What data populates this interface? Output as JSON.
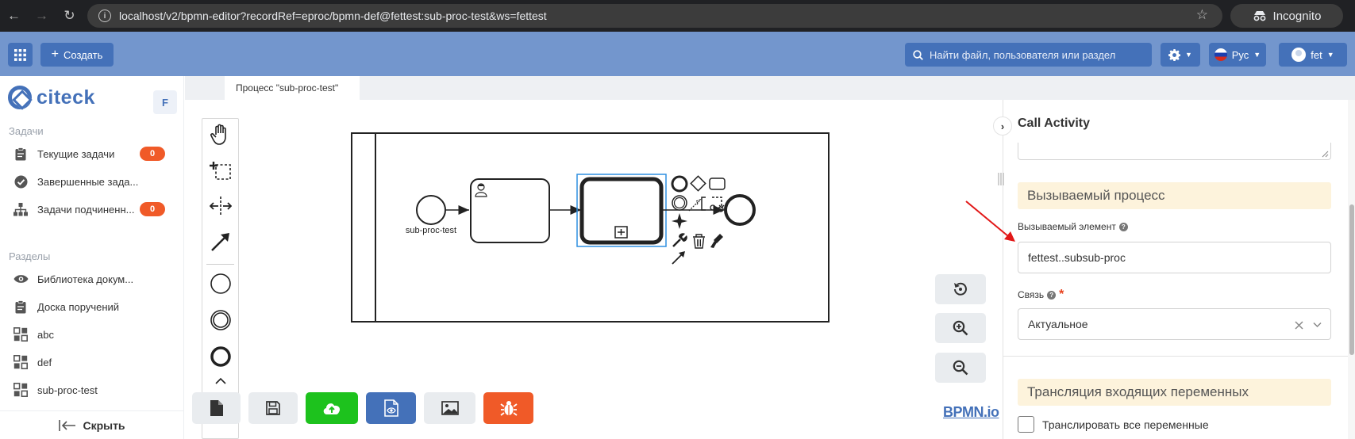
{
  "browser": {
    "url": "localhost/v2/bpmn-editor?recordRef=eproc/bpmn-def@fettest:sub-proc-test&ws=fettest",
    "mode_label": "Incognito"
  },
  "header": {
    "create_label": "Создать",
    "search_placeholder": "Найти файл, пользователя или раздел",
    "language": "Рус",
    "user": "fet",
    "brand_color": "#7396cd",
    "button_color": "#4471b9"
  },
  "sidebar": {
    "brand": "citeck",
    "workspace_badge": "F",
    "tasks_title": "Задачи",
    "tasks": [
      {
        "label": "Текущие задачи",
        "count": "0"
      },
      {
        "label": "Завершенные зада...",
        "count": ""
      },
      {
        "label": "Задачи подчиненн...",
        "count": "0"
      }
    ],
    "sections_title": "Разделы",
    "sections": [
      {
        "label": "Библиотека докум..."
      },
      {
        "label": "Доска поручений"
      },
      {
        "label": "abc"
      },
      {
        "label": "def"
      },
      {
        "label": "sub-proc-test"
      }
    ],
    "collapse_label": "Скрыть",
    "badge_color": "#f05a28"
  },
  "editor": {
    "tab_label": "Процесс \"sub-proc-test\"",
    "start_event_label": "sub-proc-test",
    "footer_logo": "BPMN.io",
    "toolbar_colors": {
      "publish": "#1dc21d",
      "preview": "#4471b9",
      "debug": "#f05a28"
    }
  },
  "panel": {
    "title": "Call Activity",
    "section_called_process": "Вызываемый процесс",
    "called_element_label": "Вызываемый элемент",
    "called_element_value": "fettest..subsub-proc",
    "binding_label": "Связь",
    "binding_value": "Актуальное",
    "section_in_vars": "Трансляция входящих переменных",
    "translate_all_label": "Транслировать все переменные",
    "section_color": "#fdf3dc"
  }
}
